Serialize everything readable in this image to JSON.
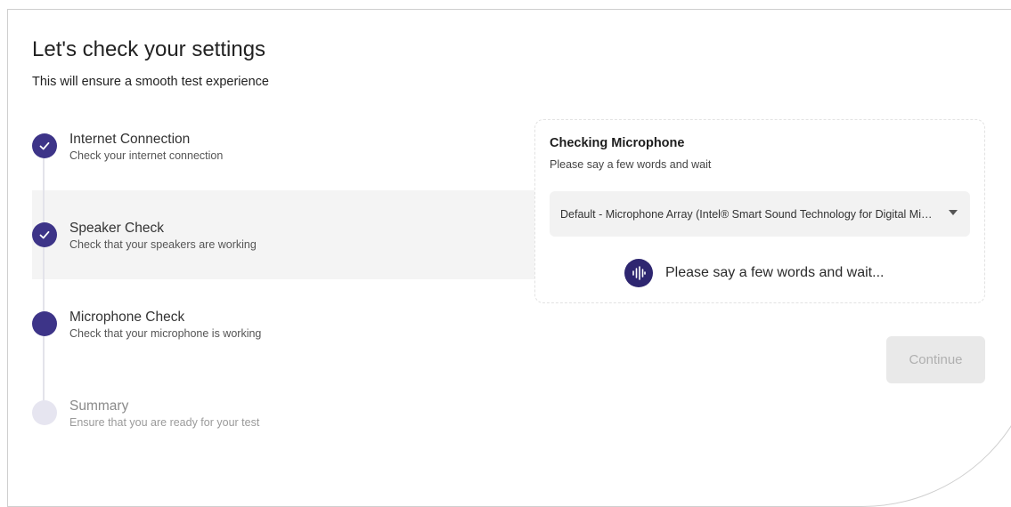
{
  "page": {
    "title": "Let's check your settings",
    "subtitle": "This will ensure a smooth test experience"
  },
  "steps": [
    {
      "title": "Internet Connection",
      "description": "Check your internet connection",
      "status": "complete"
    },
    {
      "title": "Speaker Check",
      "description": "Check that your speakers are working",
      "status": "complete"
    },
    {
      "title": "Microphone Check",
      "description": "Check that your microphone is working",
      "status": "active"
    },
    {
      "title": "Summary",
      "description": "Ensure that you are ready for your test",
      "status": "pending"
    }
  ],
  "mic_card": {
    "title": "Checking Microphone",
    "subtitle": "Please say a few words and wait",
    "device_selected": "Default - Microphone Array (Intel® Smart Sound Technology for Digital Microphones)",
    "status_text": "Please say a few words and wait..."
  },
  "actions": {
    "continue_label": "Continue"
  },
  "icons": {
    "step_complete": "check-icon",
    "mic_status": "sound-wave-icon",
    "dropdown": "chevron-down-icon"
  },
  "colors": {
    "accent": "#3d3488",
    "step_pending": "#e6e5f0",
    "button_disabled_bg": "#e9e9e9",
    "button_disabled_text": "#b0b0b0"
  }
}
